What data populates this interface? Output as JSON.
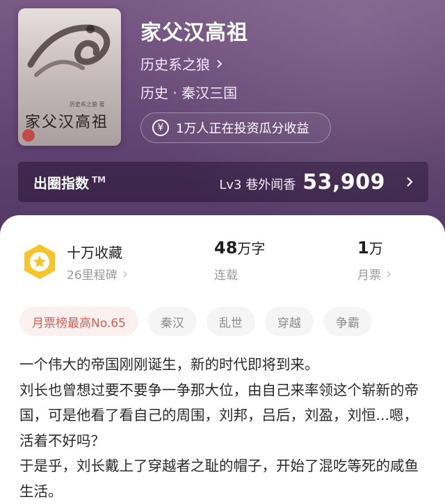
{
  "book": {
    "title": "家父汉高祖",
    "author": "历史系之狼",
    "genre": "历史 · 秦汉三国",
    "invest_text": "1万人正在投资瓜分收益",
    "cover": {
      "title": "家父汉高祖",
      "author_line": "历史系之狼 著"
    }
  },
  "index_bar": {
    "title": "出圈指数",
    "tm": "TM",
    "level": "Lv3 巷外闻香",
    "score": "53,909"
  },
  "stats": [
    {
      "main": "十万收藏",
      "sub": "26里程碑"
    },
    {
      "main_num": "48",
      "main_unit": "万字",
      "sub": "连载"
    },
    {
      "main_num": "1",
      "main_unit": "万",
      "sub": "月票"
    }
  ],
  "tags": [
    "月票榜最高No.65",
    "秦汉",
    "乱世",
    "穿越",
    "争霸"
  ],
  "description": [
    "一个伟大的帝国刚刚诞生，新的时代即将到来。",
    "刘长也曾想过要不要争一争那大位，由自己来率领这个崭新的帝国，可是他看了看自己的周围，刘邦，吕后，刘盈，刘恒...嗯，活着不好吗？",
    "于是乎，刘长戴上了穿越者之耻的帽子，开始了混吃等死的咸鱼生活。"
  ],
  "colors": {
    "header_bg": "#6b4c7a",
    "accent_red": "#e25b4b",
    "medal_yellow": "#f7c52b"
  },
  "icons": {
    "author_chevron": "chevron-right-icon",
    "invest": "yen-icon",
    "index_chevron": "chevron-right-icon",
    "medal": "star-medal-icon"
  }
}
